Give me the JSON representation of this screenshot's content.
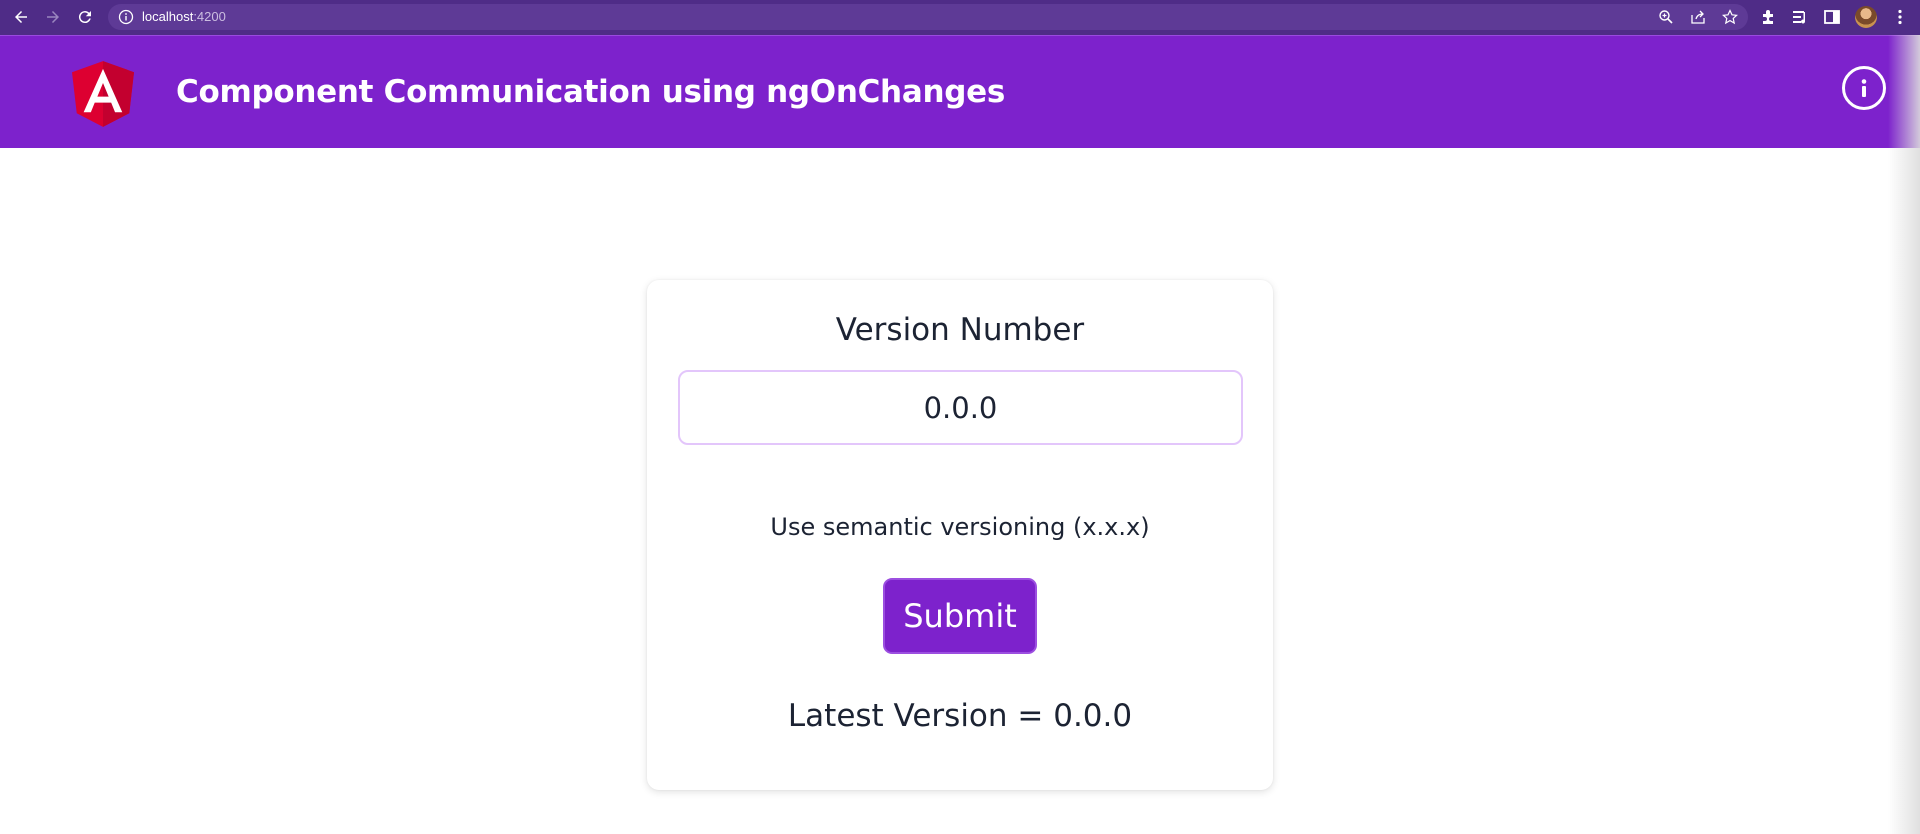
{
  "browser": {
    "url_host": "localhost",
    "url_port": ":4200",
    "icons": [
      "back-icon",
      "forward-icon",
      "reload-icon",
      "site-info-icon",
      "zoom-icon",
      "share-icon",
      "bookmark-star-icon",
      "extensions-icon",
      "media-controls-icon",
      "side-panel-icon",
      "profile-avatar",
      "menu-kebab-icon"
    ]
  },
  "header": {
    "title": "Component Communication using ngOnChanges",
    "logo": "angular-logo",
    "info_icon": "info-icon"
  },
  "form": {
    "label": "Version Number",
    "input_value": "0.0.0",
    "hint": "Use semantic versioning (x.x.x)",
    "submit_label": "Submit",
    "latest_version_text": "Latest Version = 0.0.0"
  },
  "colors": {
    "brand_purple": "#7d22cc",
    "browser_bar": "#4f2c87",
    "input_border": "#e3c6fb",
    "angular_red": "#dd0031"
  }
}
